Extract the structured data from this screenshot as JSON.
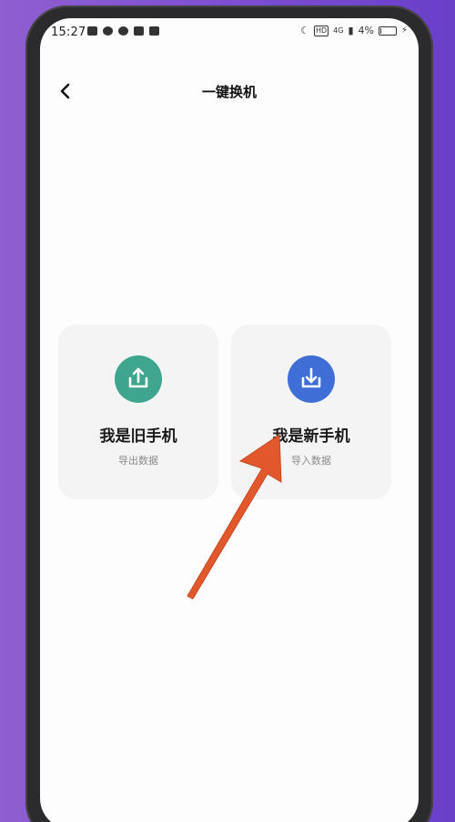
{
  "status_bar": {
    "time": "15:27",
    "network_badge": "HD",
    "network_type": "4G",
    "battery": "4%"
  },
  "header": {
    "title": "一键换机",
    "back_icon": "chevron-left-icon"
  },
  "options": [
    {
      "title": "我是旧手机",
      "subtitle": "导出数据",
      "icon": "upload-icon",
      "color": "#3fa58e"
    },
    {
      "title": "我是新手机",
      "subtitle": "导入数据",
      "icon": "download-icon",
      "color": "#3f6fd6"
    }
  ],
  "annotation": {
    "arrow_color": "#e0582b",
    "target": "我是新手机"
  }
}
